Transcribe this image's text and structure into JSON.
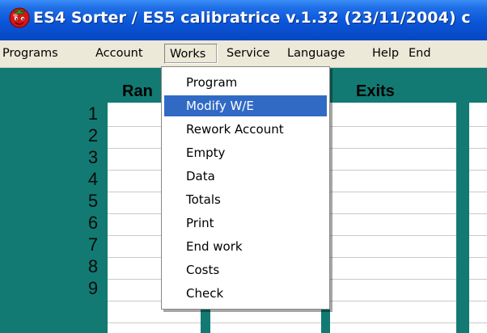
{
  "window": {
    "title": "ES4 Sorter / ES5 calibratrice  v.1.32 (23/11/2004) c",
    "icon": "tomato-icon"
  },
  "menubar": {
    "items": [
      {
        "label": "Programs"
      },
      {
        "label": "Account"
      },
      {
        "label": "Works"
      },
      {
        "label": "Service"
      },
      {
        "label": "Language"
      },
      {
        "label": "Help"
      },
      {
        "label": "End"
      }
    ],
    "open_menu": "Works"
  },
  "works_menu": {
    "items": [
      {
        "label": "Program"
      },
      {
        "label": "Modify W/E"
      },
      {
        "label": "Rework Account"
      },
      {
        "label": "Empty"
      },
      {
        "label": "Data"
      },
      {
        "label": "Totals"
      },
      {
        "label": "Print"
      },
      {
        "label": "End work"
      },
      {
        "label": "Costs"
      },
      {
        "label": "Check"
      }
    ],
    "highlighted": "Modify W/E"
  },
  "table": {
    "headers": {
      "ranges": "Ran",
      "exits": "Exits"
    },
    "row_numbers": [
      "1",
      "2",
      "3",
      "4",
      "5",
      "6",
      "7",
      "8",
      "9"
    ]
  },
  "colors": {
    "teal_background": "#127a72",
    "menu_highlight": "#316ac5",
    "titlebar": "#0a55d8"
  }
}
